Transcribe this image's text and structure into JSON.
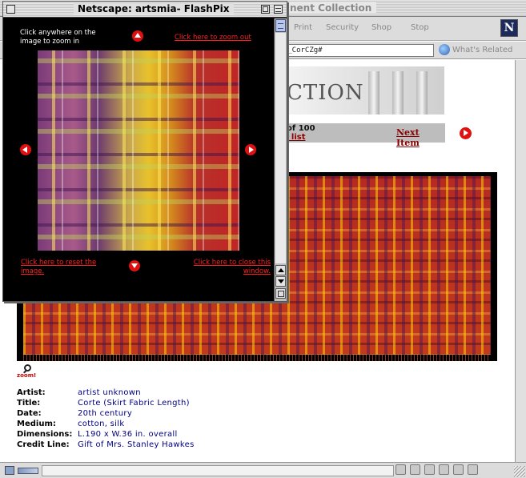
{
  "browser": {
    "title": "nent Collection",
    "toolbar": [
      "Print",
      "Security",
      "Shop",
      "Stop"
    ],
    "location_value": "uia_CorCZg#",
    "whats_related": "What's Related"
  },
  "page": {
    "banner_text": "CTION",
    "nav": {
      "count_text": "of 100",
      "list_link": "m list",
      "next_label": "Next Item"
    },
    "zoom_label": "zoom!",
    "details": [
      {
        "label": "Artist:",
        "value": "artist unknown"
      },
      {
        "label": "Title:",
        "value": "Corte (Skirt Fabric Length)"
      },
      {
        "label": "Date:",
        "value": "20th century"
      },
      {
        "label": "Medium:",
        "value": "cotton, silk"
      },
      {
        "label": "Dimensions:",
        "value": "L.190 x W.36 in. overall"
      },
      {
        "label": "Credit Line:",
        "value": "Gift of Mrs. Stanley Hawkes"
      }
    ]
  },
  "popup": {
    "title": "Netscape: artsmia- FlashPix",
    "instruction": "Click anywhere on the image to zoom in",
    "zoom_out": "Click here to zoom out",
    "reset": "Click here to reset the image.",
    "close": "Click here to close this window."
  },
  "colors": {
    "link_red": "#ff2020",
    "value_navy": "#000080",
    "button_red": "#e01010"
  },
  "icons": [
    "close-box-icon",
    "zoom-box-icon",
    "collapse-box-icon",
    "arrow-up-icon",
    "arrow-down-icon",
    "arrow-left-icon",
    "arrow-right-icon",
    "magnifier-icon",
    "netscape-logo-icon",
    "globe-icon",
    "lock-icon"
  ]
}
